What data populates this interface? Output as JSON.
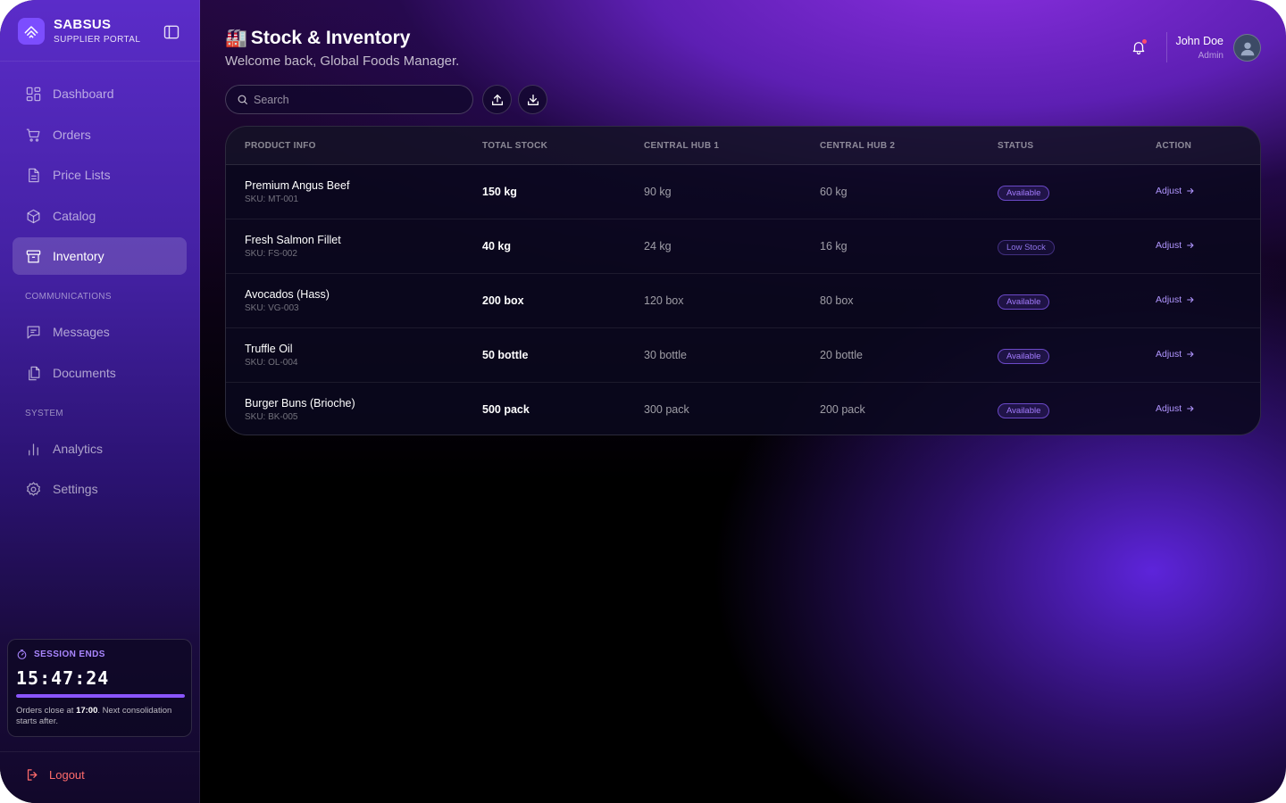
{
  "brand": {
    "name": "SABSUS",
    "subtitle": "SUPPLIER PORTAL"
  },
  "sidebar": {
    "items": [
      {
        "label": "Dashboard",
        "icon": "dashboard-icon"
      },
      {
        "label": "Orders",
        "icon": "cart-icon"
      },
      {
        "label": "Price Lists",
        "icon": "document-icon"
      },
      {
        "label": "Catalog",
        "icon": "box-icon"
      },
      {
        "label": "Inventory",
        "icon": "archive-icon",
        "active": true
      }
    ],
    "section_communications": "COMMUNICATIONS",
    "communications": [
      {
        "label": "Messages",
        "icon": "message-icon"
      },
      {
        "label": "Documents",
        "icon": "files-icon"
      }
    ],
    "section_system": "SYSTEM",
    "system": [
      {
        "label": "Analytics",
        "icon": "bar-chart-icon"
      },
      {
        "label": "Settings",
        "icon": "gear-icon"
      }
    ],
    "logout": "Logout"
  },
  "session": {
    "heading": "SESSION ENDS",
    "time": "15:47:24",
    "progress": 1.0,
    "note_prefix": "Orders close at ",
    "note_time": "17:00",
    "note_suffix": ". Next consolidation starts after."
  },
  "header": {
    "title_emoji": "🏭",
    "title": "Stock & Inventory",
    "subtitle": "Welcome back, Global Foods Manager."
  },
  "user": {
    "name": "John Doe",
    "role": "Admin"
  },
  "search": {
    "placeholder": "Search"
  },
  "table": {
    "headers": [
      "PRODUCT INFO",
      "TOTAL STOCK",
      "CENTRAL HUB 1",
      "CENTRAL HUB 2",
      "STATUS",
      "ACTION"
    ],
    "rows": [
      {
        "name": "Premium Angus Beef",
        "sku": "SKU: MT-001",
        "total": "150 kg",
        "hub1": "90 kg",
        "hub2": "60 kg",
        "status": "Available",
        "action": "Adjust"
      },
      {
        "name": "Fresh Salmon Fillet",
        "sku": "SKU: FS-002",
        "total": "40 kg",
        "hub1": "24 kg",
        "hub2": "16 kg",
        "status": "Low Stock",
        "action": "Adjust"
      },
      {
        "name": "Avocados (Hass)",
        "sku": "SKU: VG-003",
        "total": "200 box",
        "hub1": "120 box",
        "hub2": "80 box",
        "status": "Available",
        "action": "Adjust"
      },
      {
        "name": "Truffle Oil",
        "sku": "SKU: OL-004",
        "total": "50 bottle",
        "hub1": "30 bottle",
        "hub2": "20 bottle",
        "status": "Available",
        "action": "Adjust"
      },
      {
        "name": "Burger Buns (Brioche)",
        "sku": "SKU: BK-005",
        "total": "500 pack",
        "hub1": "300 pack",
        "hub2": "200 pack",
        "status": "Available",
        "action": "Adjust"
      }
    ]
  },
  "colors": {
    "accent": "#8a55ff",
    "danger": "#ff6b6b",
    "badge_text": "#a47cff"
  }
}
